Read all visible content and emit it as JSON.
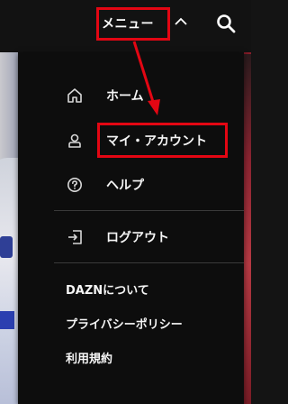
{
  "header": {
    "menu_label": "メニュー",
    "icons": [
      "chevron-up-icon",
      "search-icon"
    ]
  },
  "menu": {
    "items": [
      {
        "label": "ホーム",
        "icon": "home-icon"
      },
      {
        "label": "マイ・アカウント",
        "icon": "user-icon"
      },
      {
        "label": "ヘルプ",
        "icon": "help-icon"
      },
      {
        "label": "ログアウト",
        "icon": "logout-icon"
      }
    ],
    "links": [
      {
        "label": "DAZNについて"
      },
      {
        "label": "プライバシーポリシー"
      },
      {
        "label": "利用規約"
      }
    ]
  },
  "colors": {
    "header_bg": "#121212",
    "panel_bg": "#0d0d0d",
    "text": "#f5f5f5",
    "annotation": "#e30613"
  }
}
